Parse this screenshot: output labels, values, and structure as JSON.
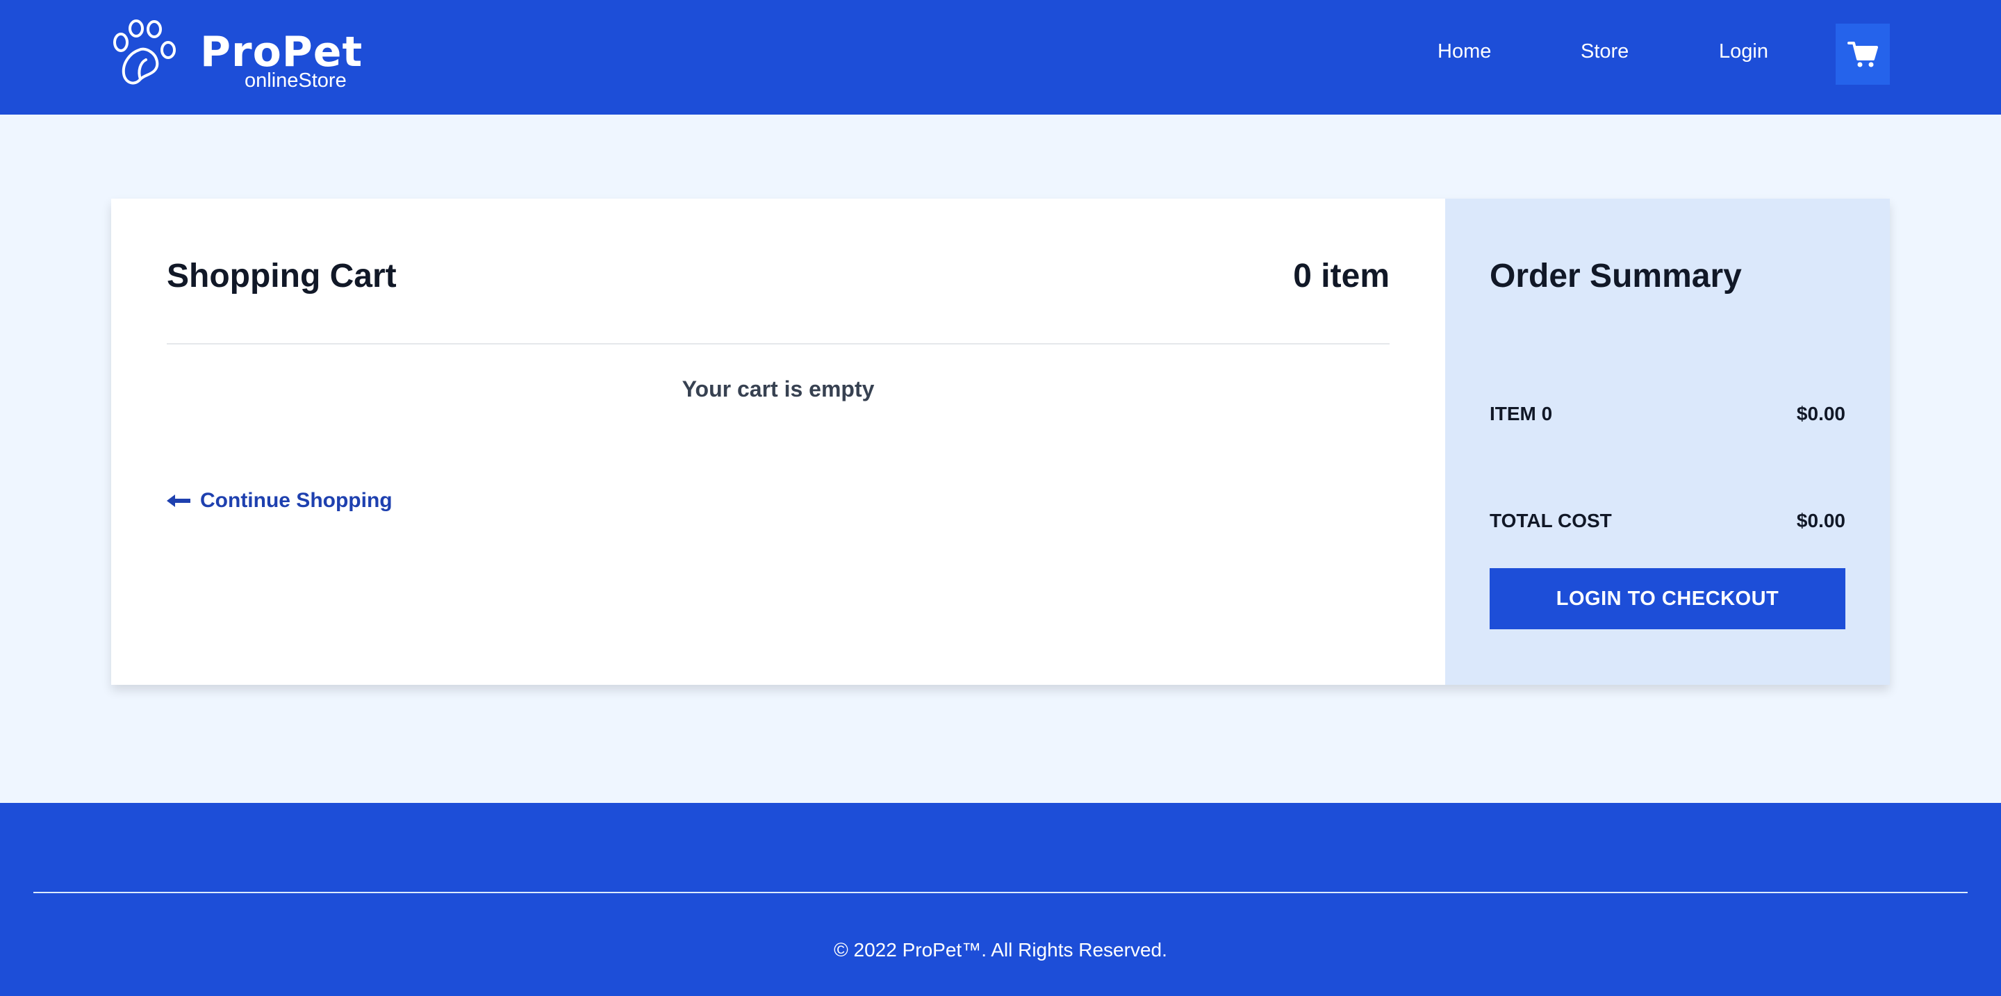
{
  "header": {
    "brand": "ProPet",
    "brand_sub": "onlineStore",
    "nav": {
      "home": "Home",
      "store": "Store",
      "login": "Login"
    },
    "cart_icon": "cart-icon",
    "logo_icon": "paw-icon"
  },
  "cart": {
    "title": "Shopping Cart",
    "count": "0 item",
    "empty_message": "Your cart is empty",
    "continue_label": "Continue Shopping",
    "continue_icon": "arrow-left-icon"
  },
  "summary": {
    "title": "Order Summary",
    "item_label": "ITEM 0",
    "item_value": "$0.00",
    "total_label": "TOTAL COST",
    "total_value": "$0.00",
    "checkout_label": "LOGIN TO CHECKOUT"
  },
  "footer": {
    "copyright": "© 2022 ProPet™. All Rights Reserved."
  },
  "colors": {
    "brand_blue": "#1d4ed8",
    "page_bg": "#eff6ff",
    "summary_bg": "#dbe8fb",
    "link_blue": "#1e40af"
  }
}
